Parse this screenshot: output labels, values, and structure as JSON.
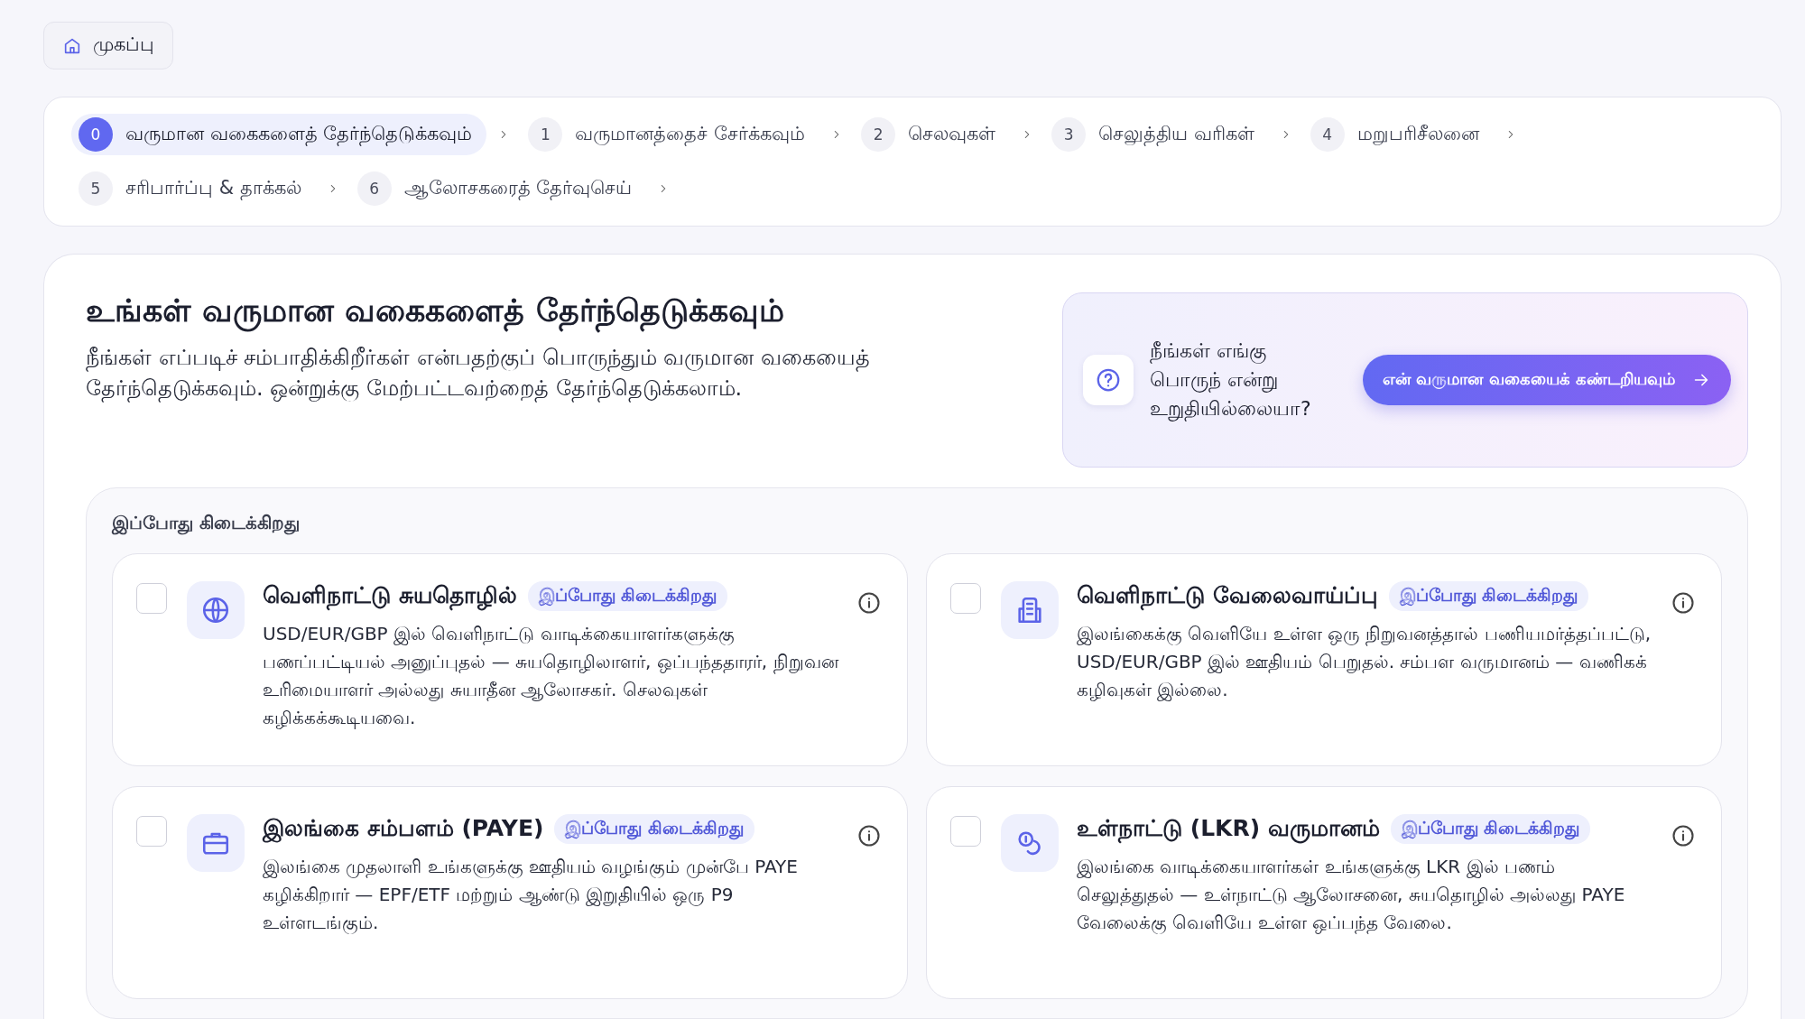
{
  "home_button": {
    "label": "முகப்பு"
  },
  "steps": [
    {
      "number": "0",
      "label": "வருமான வகைகளைத் தேர்ந்தெடுக்கவும்",
      "selected": true
    },
    {
      "number": "1",
      "label": "வருமானத்தைச் சேர்க்கவும்",
      "selected": false
    },
    {
      "number": "2",
      "label": "செலவுகள்",
      "selected": false
    },
    {
      "number": "3",
      "label": "செலுத்திய வரிகள்",
      "selected": false
    },
    {
      "number": "4",
      "label": "மறுபரிசீலனை",
      "selected": false
    },
    {
      "number": "5",
      "label": "சரிபார்ப்பு & தாக்கல்",
      "selected": false
    },
    {
      "number": "6",
      "label": "ஆலோசகரைத் தேர்வுசெய்",
      "selected": false
    }
  ],
  "heading": {
    "title": "உங்கள் வருமான வகைகளைத் தேர்ந்தெடுக்கவும்",
    "description": "நீங்கள் எப்படிச் சம்பாதிக்கிறீர்கள் என்பதற்குப் பொருந்தும் வருமான வகையைத் தேர்ந்தெடுக்கவும். ஒன்றுக்கு மேற்பட்டவற்றைத் தேர்ந்தெடுக்கலாம்."
  },
  "help": {
    "question": "நீங்கள் எங்கு பொருந் என்று உறுதியில்லையா?",
    "button": "என் வருமான வகையைக் கண்டறியவும்"
  },
  "section": {
    "label": "இப்போது கிடைக்கிறது",
    "cards": [
      {
        "title": "வெளிநாட்டு சுயதொழில்",
        "badge": "இப்போது கிடைக்கிறது",
        "description": "USD/EUR/GBP இல் வெளிநாட்டு வாடிக்கையாளர்களுக்கு பணப்பட்டியல் அனுப்புதல் — சுயதொழிலாளர், ஒப்பந்ததாரர், நிறுவன உரிமையாளர் அல்லது சுயாதீன ஆலோசகர். செலவுகள் கழிக்கக்கூடியவை.",
        "checked": false
      },
      {
        "title": "வெளிநாட்டு வேலைவாய்ப்பு",
        "badge": "இப்போது கிடைக்கிறது",
        "description": "இலங்கைக்கு வெளியே உள்ள ஒரு நிறுவனத்தால் பணியமர்த்தப்பட்டு, USD/EUR/GBP இல் ஊதியம் பெறுதல். சம்பள வருமானம் — வணிகக் கழிவுகள் இல்லை.",
        "checked": false
      },
      {
        "title": "இலங்கை சம்பளம் (PAYE)",
        "badge": "இப்போது கிடைக்கிறது",
        "description": "இலங்கை முதலாளி உங்களுக்கு ஊதியம் வழங்கும் முன்பே PAYE கழிக்கிறார் — EPF/ETF மற்றும் ஆண்டு இறுதியில் ஒரு P9 உள்ளடங்கும்.",
        "checked": false
      },
      {
        "title": "உள்நாட்டு (LKR) வருமானம்",
        "badge": "இப்போது கிடைக்கிறது",
        "description": "இலங்கை வாடிக்கையாளர்கள் உங்களுக்கு LKR இல் பணம் செலுத்துதல் — உள்நாட்டு ஆலோசனை, சுயதொழில் அல்லது PAYE வேலைக்கு வெளியே உள்ள ஒப்பந்த வேலை.",
        "checked": false
      }
    ]
  }
}
